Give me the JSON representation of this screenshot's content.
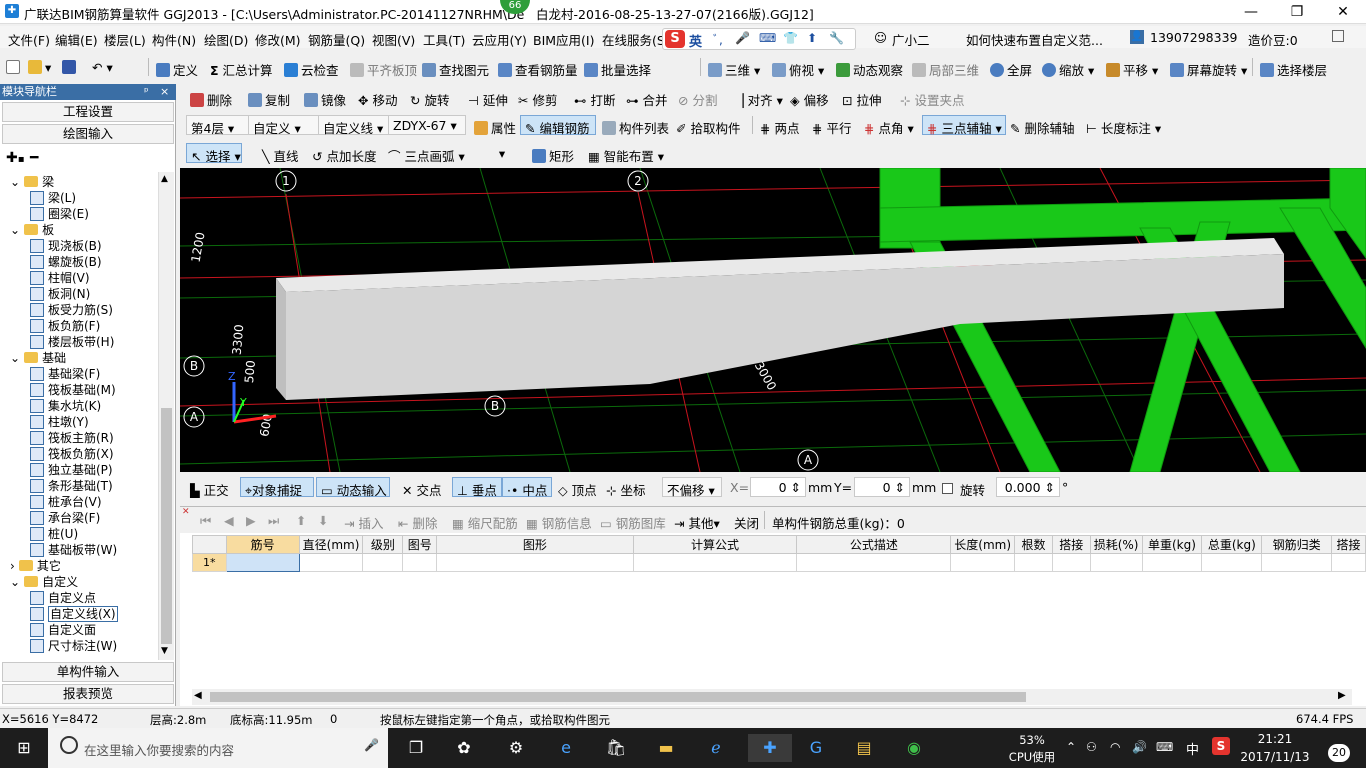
{
  "window": {
    "title": "广联达BIM钢筋算量软件 GGJ2013 - [C:\\Users\\Administrator.PC-20141127NRHM\\De",
    "title_tail": "白龙村-2016-08-25-13-27-07(2166版).GGJ12]",
    "badge": "66",
    "min": "—",
    "max": "❐",
    "close": "✕"
  },
  "menu": [
    "文件(F)",
    "编辑(E)",
    "楼层(L)",
    "构件(N)",
    "绘图(D)",
    "修改(M)",
    "钢筋量(Q)",
    "视图(V)",
    "工具(T)",
    "云应用(Y)",
    "BIM应用(I)",
    "在线服务(S)"
  ],
  "menu_right": {
    "help_link": "如何快速布置自定义范...",
    "user_phone": "13907298339",
    "credits": "造价豆:0",
    "guangxiao": "广小二",
    "ime_lang": "英"
  },
  "toolbar1": {
    "define": "定义",
    "sum": "汇总计算",
    "cloud_check": "云检查",
    "level_top": "平齐板顶",
    "find": "查找图元",
    "view_rebar": "查看钢筋量",
    "batch": "批量选择",
    "view3d": "三维",
    "topview": "俯视",
    "dynamic": "动态观察",
    "local3d": "局部三维",
    "fullscreen": "全屏",
    "zoom": "缩放",
    "pan": "平移",
    "rotate_screen": "屏幕旋转",
    "select_floor": "选择楼层"
  },
  "toolbar2": {
    "delete": "删除",
    "copy": "复制",
    "mirror": "镜像",
    "move": "移动",
    "rotate": "旋转",
    "extend": "延伸",
    "trim": "修剪",
    "break": "打断",
    "merge": "合并",
    "split": "分割",
    "align": "对齐",
    "offset": "偏移",
    "stretch": "拉伸",
    "set_pivot": "设置夹点"
  },
  "toolbar3": {
    "floor": "第4层",
    "type": "自定义",
    "subtype": "自定义线",
    "component": "ZDYX-67",
    "property": "属性",
    "edit_rebar": "编辑钢筋",
    "comp_list": "构件列表",
    "pick": "拾取构件",
    "two_point": "两点",
    "parallel": "平行",
    "point_angle": "点角",
    "three_point_aux": "三点辅轴",
    "del_aux": "删除辅轴",
    "length_mark": "长度标注"
  },
  "toolbar4": {
    "select": "选择",
    "line": "直线",
    "point_len": "点加长度",
    "arc": "三点画弧",
    "rect": "矩形",
    "smart": "智能布置"
  },
  "nav": {
    "header": "模块导航栏",
    "pin": "ᵖ",
    "close": "×",
    "project_settings": "工程设置",
    "drawing_input": "绘图输入",
    "single_input": "单构件输入",
    "report": "报表预览"
  },
  "tree": [
    {
      "label": "梁",
      "level": 0,
      "folder": true
    },
    {
      "label": "梁(L)",
      "level": 1
    },
    {
      "label": "圈梁(E)",
      "level": 1
    },
    {
      "label": "板",
      "level": 0,
      "folder": true
    },
    {
      "label": "现浇板(B)",
      "level": 1
    },
    {
      "label": "螺旋板(B)",
      "level": 1
    },
    {
      "label": "柱帽(V)",
      "level": 1
    },
    {
      "label": "板洞(N)",
      "level": 1
    },
    {
      "label": "板受力筋(S)",
      "level": 1
    },
    {
      "label": "板负筋(F)",
      "level": 1
    },
    {
      "label": "楼层板带(H)",
      "level": 1
    },
    {
      "label": "基础",
      "level": 0,
      "folder": true
    },
    {
      "label": "基础梁(F)",
      "level": 1
    },
    {
      "label": "筏板基础(M)",
      "level": 1
    },
    {
      "label": "集水坑(K)",
      "level": 1
    },
    {
      "label": "柱墩(Y)",
      "level": 1
    },
    {
      "label": "筏板主筋(R)",
      "level": 1
    },
    {
      "label": "筏板负筋(X)",
      "level": 1
    },
    {
      "label": "独立基础(P)",
      "level": 1
    },
    {
      "label": "条形基础(T)",
      "level": 1
    },
    {
      "label": "桩承台(V)",
      "level": 1
    },
    {
      "label": "承台梁(F)",
      "level": 1
    },
    {
      "label": "桩(U)",
      "level": 1
    },
    {
      "label": "基础板带(W)",
      "level": 1
    },
    {
      "label": "其它",
      "level": 0,
      "folder": true,
      "collapsed": true
    },
    {
      "label": "自定义",
      "level": 0,
      "folder": true
    },
    {
      "label": "自定义点",
      "level": 1
    },
    {
      "label": "自定义线(X)",
      "level": 1,
      "selected": true
    },
    {
      "label": "自定义面",
      "level": 1
    },
    {
      "label": "尺寸标注(W)",
      "level": 1
    }
  ],
  "viewport": {
    "axis_labels": [
      "1",
      "2",
      "B",
      "B",
      "A",
      "A"
    ],
    "dims": [
      "1200",
      "3300",
      "500",
      "600",
      "3000"
    ]
  },
  "snapbar": {
    "ortho": "正交",
    "snap": "对象捕捉",
    "dyn_input": "动态输入",
    "intersect": "交点",
    "perp": "垂点",
    "mid": "中点",
    "vertex": "顶点",
    "coord": "坐标",
    "offset_mode": "不偏移",
    "x_label": "X=",
    "x_val": "0",
    "y_label": "Y=",
    "y_val": "0",
    "unit": "mm",
    "rotate_label": "旋转",
    "rotate_val": "0.000",
    "deg": "°"
  },
  "rebar_toolbar": {
    "insert": "插入",
    "delete": "删除",
    "scale": "缩尺配筋",
    "info": "钢筋信息",
    "lib": "钢筋图库",
    "other": "其他",
    "close": "关闭",
    "total": "单构件钢筋总重(kg)：0"
  },
  "rebar_table": {
    "columns": [
      "筋号",
      "直径(mm)",
      "级别",
      "图号",
      "图形",
      "计算公式",
      "公式描述",
      "长度(mm)",
      "根数",
      "搭接",
      "损耗(%)",
      "单重(kg)",
      "总重(kg)",
      "钢筋归类",
      "搭接"
    ],
    "row_marker": "1*"
  },
  "status": {
    "coords": "X=5616 Y=8472",
    "floor_height": "层高:2.8m",
    "base_height": "底标高:11.95m",
    "zero": "0",
    "hint": "按鼠标左键指定第一个角点，或拾取构件图元",
    "fps": "674.4 FPS"
  },
  "taskbar": {
    "search": "在这里输入你要搜索的内容",
    "cpu_pct": "53%",
    "cpu_label": "CPU使用",
    "ime": "中",
    "time": "21:21",
    "date": "2017/11/13",
    "notify": "20"
  },
  "colors": {
    "accent": "#3a6ea5",
    "viewport_bg": "#000000",
    "green": "#19c819",
    "grid_red": "#c8141e"
  }
}
